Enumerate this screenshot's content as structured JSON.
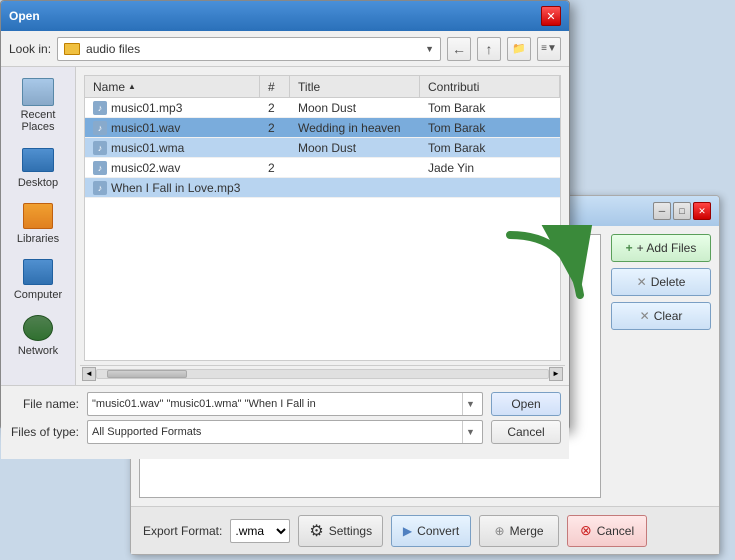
{
  "openDialog": {
    "title": "Open",
    "lookIn": {
      "label": "Look in:",
      "folderName": "audio files"
    },
    "fileList": {
      "columns": [
        {
          "id": "name",
          "label": "Name",
          "sortArrow": "▲"
        },
        {
          "id": "num",
          "label": "#"
        },
        {
          "id": "title",
          "label": "Title"
        },
        {
          "id": "contrib",
          "label": "Contributi"
        }
      ],
      "rows": [
        {
          "name": "music01.mp3",
          "num": "2",
          "title": "Moon Dust",
          "contrib": "Tom Barak",
          "selected": false,
          "selectedDark": false
        },
        {
          "name": "music01.wav",
          "num": "2",
          "title": "Wedding in heaven",
          "contrib": "Tom Barak",
          "selected": false,
          "selectedDark": true
        },
        {
          "name": "music01.wma",
          "num": "",
          "title": "Moon Dust",
          "contrib": "Tom Barak",
          "selected": true,
          "selectedDark": false
        },
        {
          "name": "music02.wav",
          "num": "2",
          "title": "",
          "contrib": "Jade Yin",
          "selected": false,
          "selectedDark": false
        },
        {
          "name": "When I Fall in Love.mp3",
          "num": "",
          "title": "",
          "contrib": "",
          "selected": false,
          "selectedDark": false
        }
      ]
    },
    "fileName": {
      "label": "File name:",
      "value": "\"music01.wav\" \"music01.wma\" \"When I Fall in"
    },
    "filesOfType": {
      "label": "Files of type:",
      "value": "All Supported Formats"
    },
    "openButton": "Open",
    "cancelButton": "Cancel"
  },
  "sidebar": {
    "items": [
      {
        "id": "recent-places",
        "label": "Recent Places"
      },
      {
        "id": "desktop",
        "label": "Desktop"
      },
      {
        "id": "libraries",
        "label": "Libraries"
      },
      {
        "id": "computer",
        "label": "Computer"
      },
      {
        "id": "network",
        "label": "Network"
      }
    ]
  },
  "mainApp": {
    "titleBar": {
      "minimizeBtn": "─",
      "maximizeBtn": "□",
      "closeBtn": "✕"
    },
    "rightButtons": {
      "addFiles": "+ Add Files",
      "delete": "Delete",
      "clear": "Clear"
    },
    "bottomBar": {
      "exportLabel": "Export Format:",
      "formatValue": ".wma",
      "settingsBtn": "Settings",
      "convertBtn": "Convert",
      "mergeBtn": "Merge",
      "cancelBtn": "Cancel"
    }
  }
}
